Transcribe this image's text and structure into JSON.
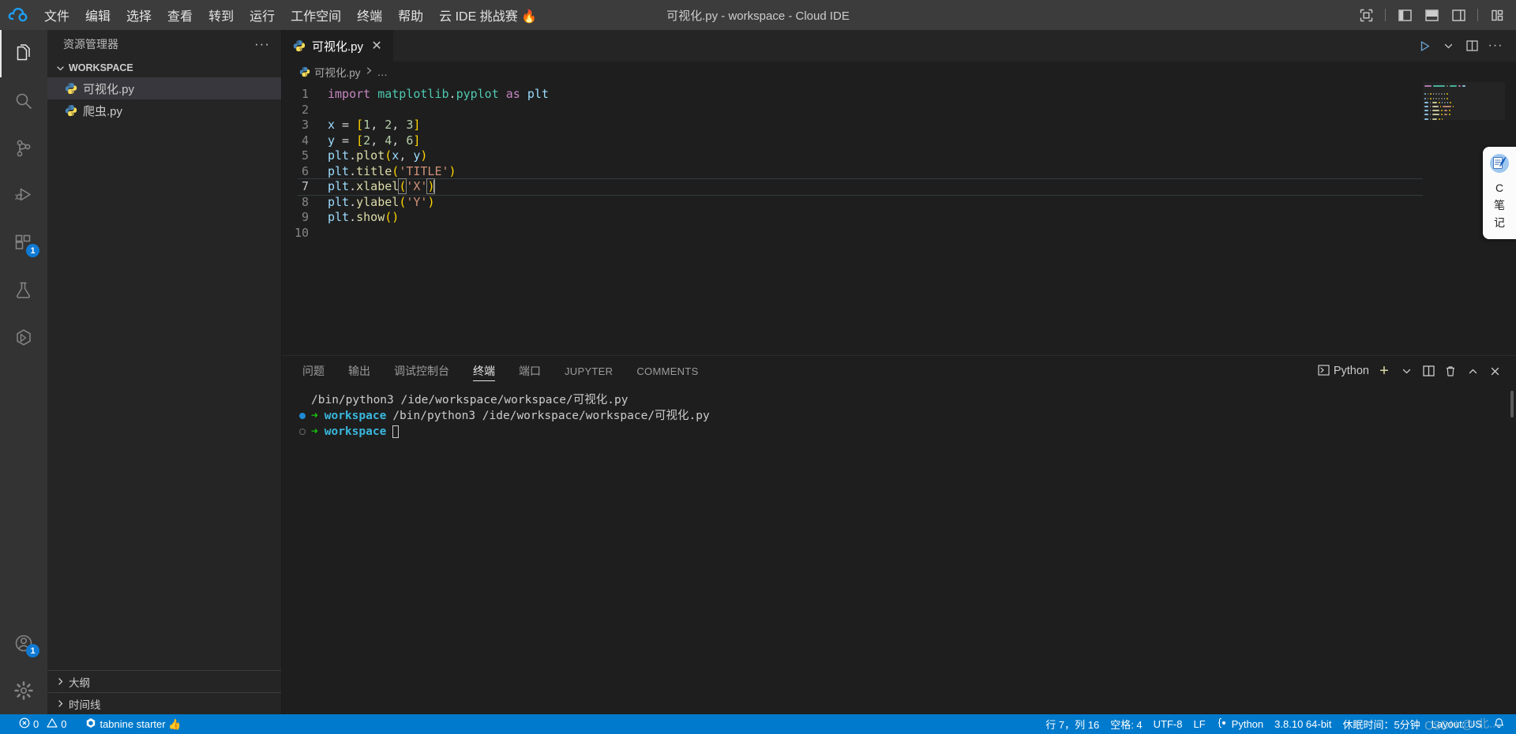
{
  "titlebar": {
    "logo_icon": "cloud-ide-logo-icon",
    "menus": [
      {
        "label": "文件",
        "name": "menu-file"
      },
      {
        "label": "编辑",
        "name": "menu-edit"
      },
      {
        "label": "选择",
        "name": "menu-selection"
      },
      {
        "label": "查看",
        "name": "menu-view"
      },
      {
        "label": "转到",
        "name": "menu-go"
      },
      {
        "label": "运行",
        "name": "menu-run"
      },
      {
        "label": "工作空间",
        "name": "menu-workspace"
      },
      {
        "label": "终端",
        "name": "menu-terminal"
      },
      {
        "label": "帮助",
        "name": "menu-help"
      },
      {
        "label": "云 IDE 挑战赛 🔥",
        "name": "menu-challenge"
      }
    ],
    "window_title": "可视化.py - workspace - Cloud IDE",
    "controls": [
      {
        "name": "center-layout-icon",
        "title": "Center Layout"
      },
      {
        "name": "toggle-primary-sidebar-icon",
        "title": "Toggle Primary Side Bar"
      },
      {
        "name": "toggle-panel-icon",
        "title": "Toggle Panel"
      },
      {
        "name": "toggle-secondary-sidebar-icon",
        "title": "Toggle Secondary Side Bar"
      },
      {
        "name": "customize-layout-icon",
        "title": "Customize Layout"
      }
    ]
  },
  "activitybar": {
    "items": [
      {
        "name": "activity-explorer",
        "icon": "files-icon",
        "label": "资源管理器",
        "active": true,
        "badge": ""
      },
      {
        "name": "activity-search",
        "icon": "search-icon",
        "label": "搜索",
        "active": false,
        "badge": ""
      },
      {
        "name": "activity-scm",
        "icon": "source-control-icon",
        "label": "源代码管理",
        "active": false,
        "badge": ""
      },
      {
        "name": "activity-run-debug",
        "icon": "run-debug-icon",
        "label": "运行和调试",
        "active": false,
        "badge": ""
      },
      {
        "name": "activity-extensions",
        "icon": "extensions-icon",
        "label": "扩展",
        "active": false,
        "badge": "1"
      },
      {
        "name": "activity-testing",
        "icon": "beaker-icon",
        "label": "测试",
        "active": false,
        "badge": ""
      },
      {
        "name": "activity-remote",
        "icon": "remote-explorer-icon",
        "label": "远程资源管理器",
        "active": false,
        "badge": ""
      }
    ],
    "bottom": [
      {
        "name": "activity-accounts",
        "icon": "account-icon",
        "label": "账户",
        "badge": "1"
      },
      {
        "name": "activity-settings",
        "icon": "gear-icon",
        "label": "管理",
        "badge": ""
      }
    ]
  },
  "sidebar": {
    "title": "资源管理器",
    "more_actions": "···",
    "workspace_label": "WORKSPACE",
    "files": [
      {
        "name": "可视化.py",
        "icon": "python-file-icon",
        "selected": true
      },
      {
        "name": "爬虫.py",
        "icon": "python-file-icon",
        "selected": false
      }
    ],
    "bottom_sections": [
      {
        "label": "大纲",
        "name": "sidebar-section-outline"
      },
      {
        "label": "时间线",
        "name": "sidebar-section-timeline"
      }
    ]
  },
  "editor": {
    "tabs": [
      {
        "label": "可视化.py",
        "icon": "python-file-icon",
        "active": true,
        "close": "✕"
      }
    ],
    "actions": [
      {
        "name": "run-python-file-icon",
        "title": "运行 Python 文件"
      },
      {
        "name": "chevron-down-icon",
        "title": "更多运行选项"
      },
      {
        "name": "split-editor-right-icon",
        "title": "向右拆分编辑器"
      },
      {
        "name": "more-actions-icon",
        "title": "更多操作",
        "glyph": "···"
      }
    ],
    "breadcrumbs": [
      {
        "label": "可视化.py",
        "icon": "python-file-icon"
      },
      {
        "label": "…",
        "icon": ""
      }
    ],
    "lines": [
      {
        "n": "1",
        "tokens": [
          {
            "t": "import",
            "c": "kw"
          },
          {
            "t": " ",
            "c": "op"
          },
          {
            "t": "matplotlib",
            "c": "mod"
          },
          {
            "t": ".",
            "c": "op"
          },
          {
            "t": "pyplot",
            "c": "mod"
          },
          {
            "t": " ",
            "c": "op"
          },
          {
            "t": "as",
            "c": "kw"
          },
          {
            "t": " ",
            "c": "op"
          },
          {
            "t": "plt",
            "c": "var"
          }
        ]
      },
      {
        "n": "2",
        "tokens": []
      },
      {
        "n": "3",
        "tokens": [
          {
            "t": "x",
            "c": "var"
          },
          {
            "t": " = ",
            "c": "op"
          },
          {
            "t": "[",
            "c": "brk1"
          },
          {
            "t": "1",
            "c": "num"
          },
          {
            "t": ", ",
            "c": "op"
          },
          {
            "t": "2",
            "c": "num"
          },
          {
            "t": ", ",
            "c": "op"
          },
          {
            "t": "3",
            "c": "num"
          },
          {
            "t": "]",
            "c": "brk1"
          }
        ]
      },
      {
        "n": "4",
        "tokens": [
          {
            "t": "y",
            "c": "var"
          },
          {
            "t": " = ",
            "c": "op"
          },
          {
            "t": "[",
            "c": "brk1"
          },
          {
            "t": "2",
            "c": "num"
          },
          {
            "t": ", ",
            "c": "op"
          },
          {
            "t": "4",
            "c": "num"
          },
          {
            "t": ", ",
            "c": "op"
          },
          {
            "t": "6",
            "c": "num"
          },
          {
            "t": "]",
            "c": "brk1"
          }
        ]
      },
      {
        "n": "5",
        "tokens": [
          {
            "t": "plt",
            "c": "var"
          },
          {
            "t": ".",
            "c": "op"
          },
          {
            "t": "plot",
            "c": "fn"
          },
          {
            "t": "(",
            "c": "brk1"
          },
          {
            "t": "x",
            "c": "var"
          },
          {
            "t": ", ",
            "c": "op"
          },
          {
            "t": "y",
            "c": "var"
          },
          {
            "t": ")",
            "c": "brk1"
          }
        ]
      },
      {
        "n": "6",
        "tokens": [
          {
            "t": "plt",
            "c": "var"
          },
          {
            "t": ".",
            "c": "op"
          },
          {
            "t": "title",
            "c": "fn"
          },
          {
            "t": "(",
            "c": "brk1"
          },
          {
            "t": "'TITLE'",
            "c": "str"
          },
          {
            "t": ")",
            "c": "brk1"
          }
        ]
      },
      {
        "n": "7",
        "active": true,
        "tokens": [
          {
            "t": "plt",
            "c": "var"
          },
          {
            "t": ".",
            "c": "op"
          },
          {
            "t": "xlabel",
            "c": "fn"
          },
          {
            "t": "(",
            "c": "brk1 bmatch"
          },
          {
            "t": "'X'",
            "c": "str"
          },
          {
            "t": ")",
            "c": "brk1 bmatch"
          }
        ],
        "cursor": true
      },
      {
        "n": "8",
        "tokens": [
          {
            "t": "plt",
            "c": "var"
          },
          {
            "t": ".",
            "c": "op"
          },
          {
            "t": "ylabel",
            "c": "fn"
          },
          {
            "t": "(",
            "c": "brk1"
          },
          {
            "t": "'Y'",
            "c": "str"
          },
          {
            "t": ")",
            "c": "brk1"
          }
        ]
      },
      {
        "n": "9",
        "tokens": [
          {
            "t": "plt",
            "c": "var"
          },
          {
            "t": ".",
            "c": "op"
          },
          {
            "t": "show",
            "c": "fn"
          },
          {
            "t": "(",
            "c": "brk1"
          },
          {
            "t": ")",
            "c": "brk1"
          }
        ]
      },
      {
        "n": "10",
        "tokens": []
      }
    ]
  },
  "panel": {
    "tabs": [
      {
        "label": "问题",
        "name": "panel-tab-problems",
        "active": false,
        "latin": false
      },
      {
        "label": "输出",
        "name": "panel-tab-output",
        "active": false,
        "latin": false
      },
      {
        "label": "调试控制台",
        "name": "panel-tab-debug-console",
        "active": false,
        "latin": false
      },
      {
        "label": "终端",
        "name": "panel-tab-terminal",
        "active": true,
        "latin": false
      },
      {
        "label": "端口",
        "name": "panel-tab-ports",
        "active": false,
        "latin": false
      },
      {
        "label": "JUPYTER",
        "name": "panel-tab-jupyter",
        "active": false,
        "latin": true
      },
      {
        "label": "COMMENTS",
        "name": "panel-tab-comments",
        "active": false,
        "latin": true
      }
    ],
    "terminal_selector_label": "Python",
    "actions": [
      {
        "name": "new-terminal-icon",
        "glyph": "+",
        "title": "新建终端"
      },
      {
        "name": "terminal-profile-chevron-icon",
        "glyph": "⌄",
        "title": "启动配置文件"
      },
      {
        "name": "split-terminal-icon",
        "title": "拆分终端"
      },
      {
        "name": "kill-terminal-icon",
        "title": "终止终端"
      },
      {
        "name": "maximize-panel-icon",
        "title": "最大化面板大小"
      },
      {
        "name": "close-panel-icon",
        "title": "关闭面板"
      }
    ],
    "terminal_lines": [
      {
        "marker": "none",
        "prompt": "",
        "text": "/bin/python3 /ide/workspace/workspace/可视化.py",
        "cursor": false
      },
      {
        "marker": "filled",
        "prompt": "workspace",
        "text": "/bin/python3 /ide/workspace/workspace/可视化.py",
        "cursor": false
      },
      {
        "marker": "hollow",
        "prompt": "workspace",
        "text": "",
        "cursor": true
      }
    ],
    "prompt_arrow": "➜"
  },
  "statusbar": {
    "left": [
      {
        "name": "status-problems",
        "icon": "error-icon",
        "text": "0",
        "icon2": "warning-icon",
        "text2": "0"
      },
      {
        "name": "status-tabnine",
        "icon": "tabnine-icon",
        "text": "tabnine starter 👍"
      }
    ],
    "right": [
      {
        "name": "status-cursor-position",
        "text": "行 7，列 16"
      },
      {
        "name": "status-indentation",
        "text": "空格: 4"
      },
      {
        "name": "status-encoding",
        "text": "UTF-8"
      },
      {
        "name": "status-eol",
        "text": "LF"
      },
      {
        "name": "status-language-mode",
        "text": "Python",
        "icon": "python-braces-icon"
      },
      {
        "name": "status-interpreter",
        "text": "3.8.10 64-bit"
      },
      {
        "name": "status-sleep-timer",
        "text": "休眠时间：5分钟"
      },
      {
        "name": "status-keyboard-layout",
        "text": "Layout: US"
      },
      {
        "name": "status-notifications",
        "text": "",
        "icon": "bell-icon"
      }
    ]
  },
  "float_widget": {
    "icon": "note-pen-icon",
    "lines": [
      "C",
      "笔",
      "记"
    ]
  },
  "watermark": "CSDN @-北..."
}
